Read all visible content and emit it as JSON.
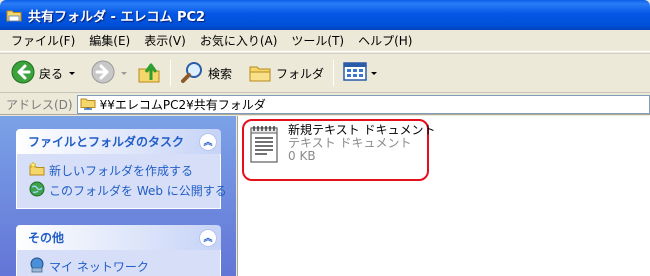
{
  "window": {
    "title": "共有フォルダ - エレコム PC2"
  },
  "menu": {
    "items": [
      "ファイル(F)",
      "編集(E)",
      "表示(V)",
      "お気に入り(A)",
      "ツール(T)",
      "ヘルプ(H)"
    ]
  },
  "toolbar": {
    "back_label": "戻る",
    "search_label": "検索",
    "folders_label": "フォルダ"
  },
  "address": {
    "label": "アドレス(D)",
    "value": "¥¥エレコムPC2¥共有フォルダ"
  },
  "tasks": {
    "file_panel_title": "ファイルとフォルダのタスク",
    "file_tasks": [
      "新しいフォルダを作成する",
      "このフォルダを Web に公開する"
    ],
    "other_panel_title": "その他",
    "other_links": [
      "マイ ネットワーク"
    ]
  },
  "files": [
    {
      "name": "新規テキスト ドキュメント",
      "type": "テキスト ドキュメント",
      "size": "0 KB"
    }
  ],
  "colors": {
    "titlebar": "#0458E5",
    "task_pane": "#7BA2E7",
    "task_link": "#215DC6",
    "highlight": "#E4101C"
  }
}
